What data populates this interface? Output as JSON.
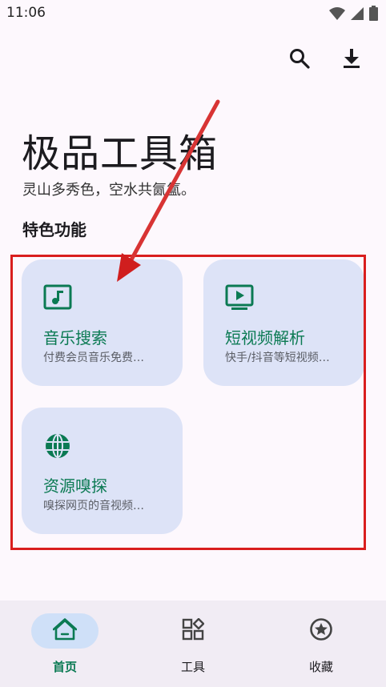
{
  "status_bar": {
    "time": "11:06",
    "icons": [
      "wifi-icon",
      "signal-icon",
      "battery-icon"
    ]
  },
  "toolbar": {
    "search_icon": "search-icon",
    "download_icon": "download-icon"
  },
  "header": {
    "title": "极品工具箱",
    "subtitle": "灵山多秀色，空水共氤氲。"
  },
  "section": {
    "title": "特色功能"
  },
  "cards": [
    {
      "title": "音乐搜索",
      "desc": "付费会员音乐免费…",
      "icon": "music-note-icon"
    },
    {
      "title": "短视频解析",
      "desc": "快手/抖音等短视频…",
      "icon": "video-play-icon"
    },
    {
      "title": "资源嗅探",
      "desc": "嗅探网页的音视频…",
      "icon": "globe-icon"
    }
  ],
  "bottom_nav": {
    "items": [
      {
        "label": "首页",
        "icon": "home-icon",
        "active": true
      },
      {
        "label": "工具",
        "icon": "apps-grid-icon",
        "active": false
      },
      {
        "label": "收藏",
        "icon": "star-badge-icon",
        "active": false
      }
    ]
  },
  "colors": {
    "accent": "#0b7a53",
    "card_bg": "#dde3f7",
    "annotation": "#d91e1e",
    "nav_bg": "#f1ecf4",
    "nav_active_pill": "#cfe0f8"
  }
}
